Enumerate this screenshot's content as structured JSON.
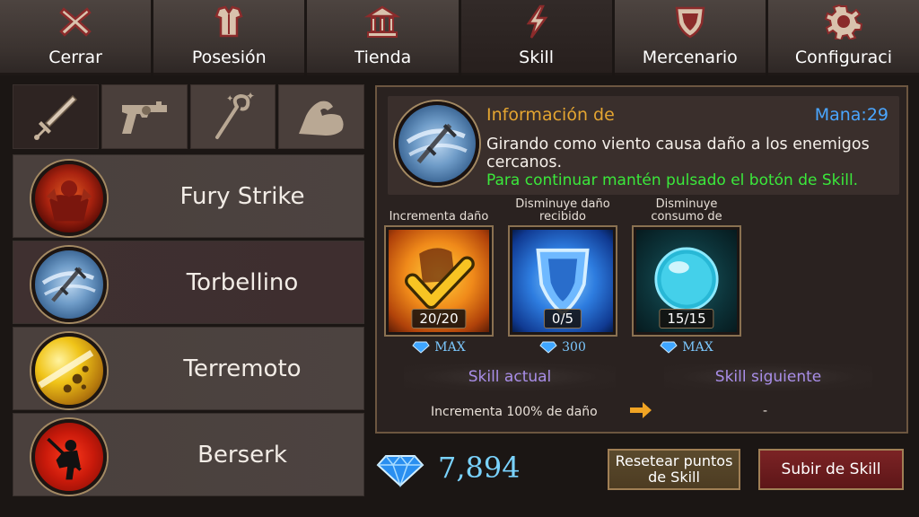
{
  "tabs": [
    {
      "label": "Cerrar",
      "icon": "close-icon"
    },
    {
      "label": "Posesión",
      "icon": "armor-icon"
    },
    {
      "label": "Tienda",
      "icon": "shop-icon"
    },
    {
      "label": "Skill",
      "icon": "lightning-icon"
    },
    {
      "label": "Mercenario",
      "icon": "shield-icon"
    },
    {
      "label": "Configuraci",
      "icon": "gear-icon"
    }
  ],
  "categories": [
    {
      "icon": "sword-icon"
    },
    {
      "icon": "revolver-icon"
    },
    {
      "icon": "staff-icon"
    },
    {
      "icon": "muscle-arm-icon"
    }
  ],
  "skills": [
    {
      "name": "Fury Strike"
    },
    {
      "name": "Torbellino"
    },
    {
      "name": "Terremoto"
    },
    {
      "name": "Berserk"
    }
  ],
  "info": {
    "title": "Información de",
    "mana_label": "Mana:",
    "mana_value": "29",
    "description": "Girando como viento causa daño a los enemigos cercanos.",
    "hint": "Para continuar mantén pulsado el botón de Skill."
  },
  "upgrades": [
    {
      "label": "Incrementa daño",
      "count": "20/20",
      "cost": "MAX"
    },
    {
      "label": "Disminuye daño recibido",
      "count": "0/5",
      "cost": "300"
    },
    {
      "label": "Disminuye consumo de",
      "count": "15/15",
      "cost": "MAX"
    }
  ],
  "levels": {
    "current_label": "Skill actual",
    "next_label": "Skill siguiente",
    "current_text": "Incrementa 100% de daño",
    "next_text": "-"
  },
  "gems": "7,894",
  "buttons": {
    "reset": "Resetear puntos de Skill",
    "upgrade": "Subir de Skill"
  },
  "colors": {
    "title": "#e4a531",
    "mana": "#4aa6ff",
    "hint": "#3be83b",
    "gems": "#7ad3ff",
    "upgrade_button": "#7c2325"
  }
}
